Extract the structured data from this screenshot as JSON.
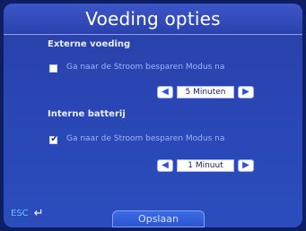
{
  "header": {
    "title": "Voeding opties"
  },
  "external_power": {
    "section_label": "Externe voeding",
    "option_label": "Ga naar de Stroom besparen Modus na",
    "checked": false,
    "value": "5 Minuten"
  },
  "internal_battery": {
    "section_label": "Interne batterij",
    "option_label": "Ga naar de Stroom besparen Modus na",
    "checked": true,
    "value": "1 Minuut"
  },
  "footer": {
    "esc_label": "ESC",
    "save_label": "Opslaan"
  },
  "icons": {
    "left_arrow": "left-arrow-icon",
    "right_arrow": "right-arrow-icon",
    "back_arrow": "back-arrow-icon",
    "checkmark": "checkmark-icon"
  },
  "colors": {
    "background": "#2a46b4",
    "title_bar": "#3d56c8",
    "label_text": "#9fb3ff",
    "section_text": "#e9edff",
    "esc_text": "#6ec1ff"
  }
}
